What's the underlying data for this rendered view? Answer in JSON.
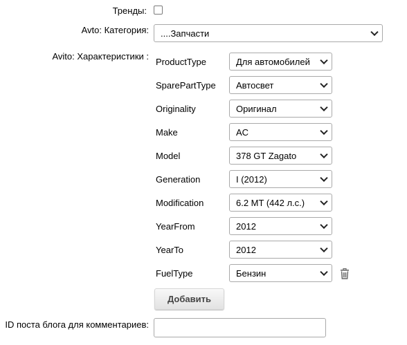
{
  "trends": {
    "label": "Тренды:",
    "checked": false
  },
  "category": {
    "label": "Avto: Категория:",
    "value": "....Запчасти"
  },
  "characteristics": {
    "label": "Avito: Характеристики :",
    "rows": [
      {
        "name": "ProductType",
        "value": "Для автомобилей"
      },
      {
        "name": "SparePartType",
        "value": "Автосвет"
      },
      {
        "name": "Originality",
        "value": "Оригинал"
      },
      {
        "name": "Make",
        "value": "AC"
      },
      {
        "name": "Model",
        "value": "378 GT Zagato"
      },
      {
        "name": "Generation",
        "value": "I (2012)"
      },
      {
        "name": "Modification",
        "value": "6.2 MT (442 л.с.)"
      },
      {
        "name": "YearFrom",
        "value": "2012"
      },
      {
        "name": "YearTo",
        "value": "2012"
      },
      {
        "name": "FuelType",
        "value": "Бензин"
      }
    ],
    "delete_icon": "trash-icon",
    "add_button_label": "Добавить"
  },
  "blog_post": {
    "label": "ID поста блога для комментариев:",
    "value": ""
  }
}
